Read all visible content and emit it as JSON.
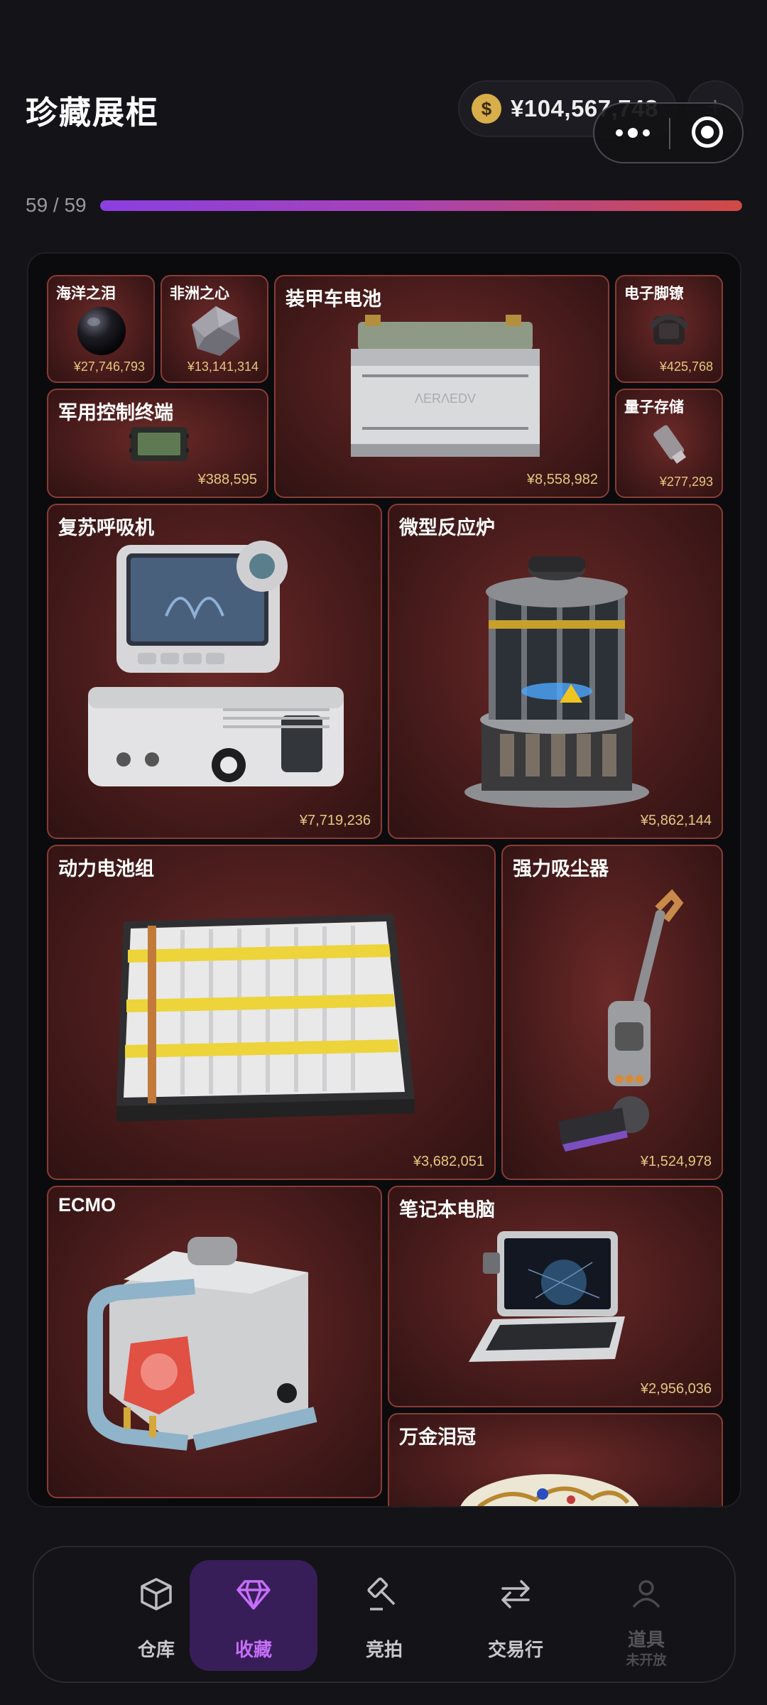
{
  "header": {
    "title": "珍藏展柜",
    "coin_icon": "$",
    "balance": "¥104,567,748",
    "add_button": "+"
  },
  "progress": {
    "text": "59 / 59",
    "collected": 59,
    "total": 59,
    "gradient_colors": [
      "#8a3fe0",
      "#d04a44"
    ]
  },
  "items": [
    {
      "name": "海洋之泪",
      "price": "¥27,746,793",
      "icon": "black-pearl"
    },
    {
      "name": "非洲之心",
      "price": "¥13,141,314",
      "icon": "rough-diamond"
    },
    {
      "name": "装甲车电池",
      "price": "¥8,558,982",
      "icon": "armored-vehicle-battery"
    },
    {
      "name": "电子脚镣",
      "price": "¥425,768",
      "icon": "electronic-ankle-monitor"
    },
    {
      "name": "军用控制终端",
      "price": "¥388,595",
      "icon": "military-control-terminal"
    },
    {
      "name": "量子存储",
      "price": "¥277,293",
      "icon": "quantum-storage-drive"
    },
    {
      "name": "复苏呼吸机",
      "price": "¥7,719,236",
      "icon": "ventilator"
    },
    {
      "name": "微型反应炉",
      "price": "¥5,862,144",
      "icon": "micro-reactor"
    },
    {
      "name": "动力电池组",
      "price": "¥3,682,051",
      "icon": "power-battery-pack"
    },
    {
      "name": "强力吸尘器",
      "price": "¥1,524,978",
      "icon": "vacuum-cleaner"
    },
    {
      "name": "ECMO",
      "price": "",
      "icon": "ecmo-machine"
    },
    {
      "name": "笔记本电脑",
      "price": "¥2,956,036",
      "icon": "rugged-laptop"
    },
    {
      "name": "万金泪冠",
      "price": "",
      "icon": "jeweled-crown"
    }
  ],
  "colors": {
    "accent": "#c56ef8",
    "price": "#e6c77e",
    "card_border": "#8a3b36"
  },
  "nav": [
    {
      "label": "仓库",
      "icon": "box-icon",
      "active": false
    },
    {
      "label": "收藏",
      "icon": "diamond-icon",
      "active": true
    },
    {
      "label": "竞拍",
      "icon": "gavel-icon",
      "active": false
    },
    {
      "label": "交易行",
      "icon": "swap-icon",
      "active": false
    },
    {
      "label": "道具",
      "sublabel": "未开放",
      "icon": "person-icon",
      "active": false,
      "disabled": true
    }
  ]
}
